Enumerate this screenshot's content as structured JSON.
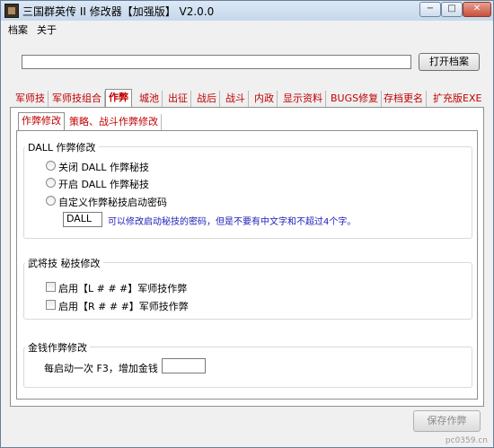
{
  "window": {
    "title": "三国群英传 II 修改器【加强版】 V2.0.0",
    "buttons": [
      "−",
      "□",
      "✕"
    ]
  },
  "menu": [
    "档案",
    "关于"
  ],
  "file": {
    "path_value": "",
    "open_button": "打开档案"
  },
  "tabs": [
    "军师技",
    "军师技组合",
    "作弊",
    "城池",
    "出征",
    "战后",
    "战斗",
    "内政",
    "显示资料",
    "BUGS修复",
    "存档更名",
    "扩充版EXE"
  ],
  "subtabs": [
    "作弊修改",
    "策略、战斗作弊修改"
  ],
  "dall_group": {
    "title": "DALL 作弊修改",
    "options": [
      "关闭 DALL 作弊秘技",
      "开启 DALL 作弊秘技",
      "自定义作弊秘技启动密码"
    ],
    "password_value": "DALL",
    "note": "可以修改启动秘技的密码，但是不要有中文字和不超过4个字。"
  },
  "generals_group": {
    "title": "武将技 秘技修改",
    "options": [
      "启用【L # # #】军师技作弊",
      "启用【R # # #】军师技作弊"
    ]
  },
  "money_group": {
    "title": "金钱作弊修改",
    "label": "每启动一次 F3，增加金钱",
    "value": ""
  },
  "save_button": "保存作弊",
  "watermark": "pc0359.cn"
}
